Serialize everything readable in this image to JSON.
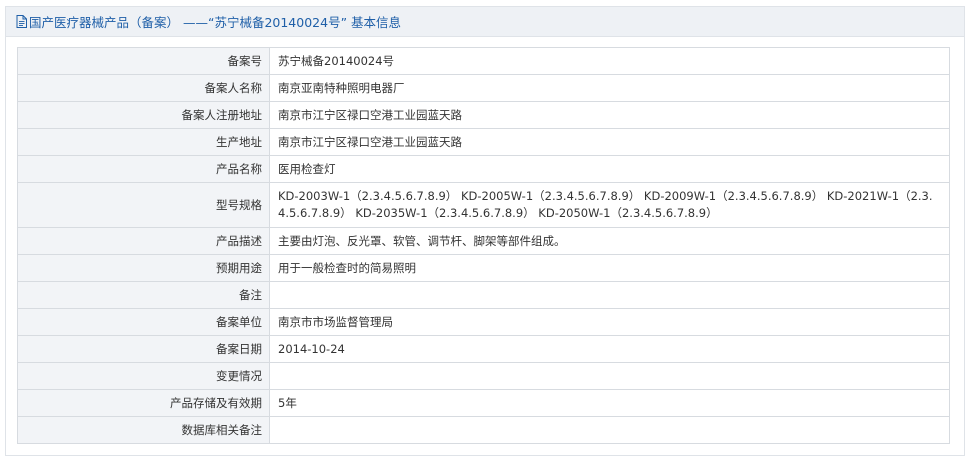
{
  "header": {
    "title": "国产医疗器械产品（备案） ——“苏宁械备20140024号” 基本信息"
  },
  "rows": [
    {
      "label": "备案号",
      "value": "苏宁械备20140024号"
    },
    {
      "label": "备案人名称",
      "value": "南京亚南特种照明电器厂"
    },
    {
      "label": "备案人注册地址",
      "value": "南京市江宁区禄口空港工业园蓝天路"
    },
    {
      "label": "生产地址",
      "value": "南京市江宁区禄口空港工业园蓝天路"
    },
    {
      "label": "产品名称",
      "value": "医用检查灯"
    },
    {
      "label": "型号规格",
      "value": "KD-2003W-1（2.3.4.5.6.7.8.9） KD-2005W-1（2.3.4.5.6.7.8.9） KD-2009W-1（2.3.4.5.6.7.8.9） KD-2021W-1（2.3.4.5.6.7.8.9） KD-2035W-1（2.3.4.5.6.7.8.9） KD-2050W-1（2.3.4.5.6.7.8.9）"
    },
    {
      "label": "产品描述",
      "value": "主要由灯泡、反光罩、软管、调节杆、脚架等部件组成。"
    },
    {
      "label": "预期用途",
      "value": "用于一般检查时的简易照明"
    },
    {
      "label": "备注",
      "value": ""
    },
    {
      "label": "备案单位",
      "value": "南京市市场监督管理局"
    },
    {
      "label": "备案日期",
      "value": "2014-10-24"
    },
    {
      "label": "变更情况",
      "value": ""
    },
    {
      "label": "产品存储及有效期",
      "value": "5年"
    },
    {
      "label": "数据库相关备注",
      "value": ""
    }
  ],
  "icons": {
    "header_icon": "document-icon"
  },
  "colors": {
    "header_text": "#1f5fa8",
    "label_bg": "#f2f4f7",
    "border": "#d7dbe0"
  }
}
